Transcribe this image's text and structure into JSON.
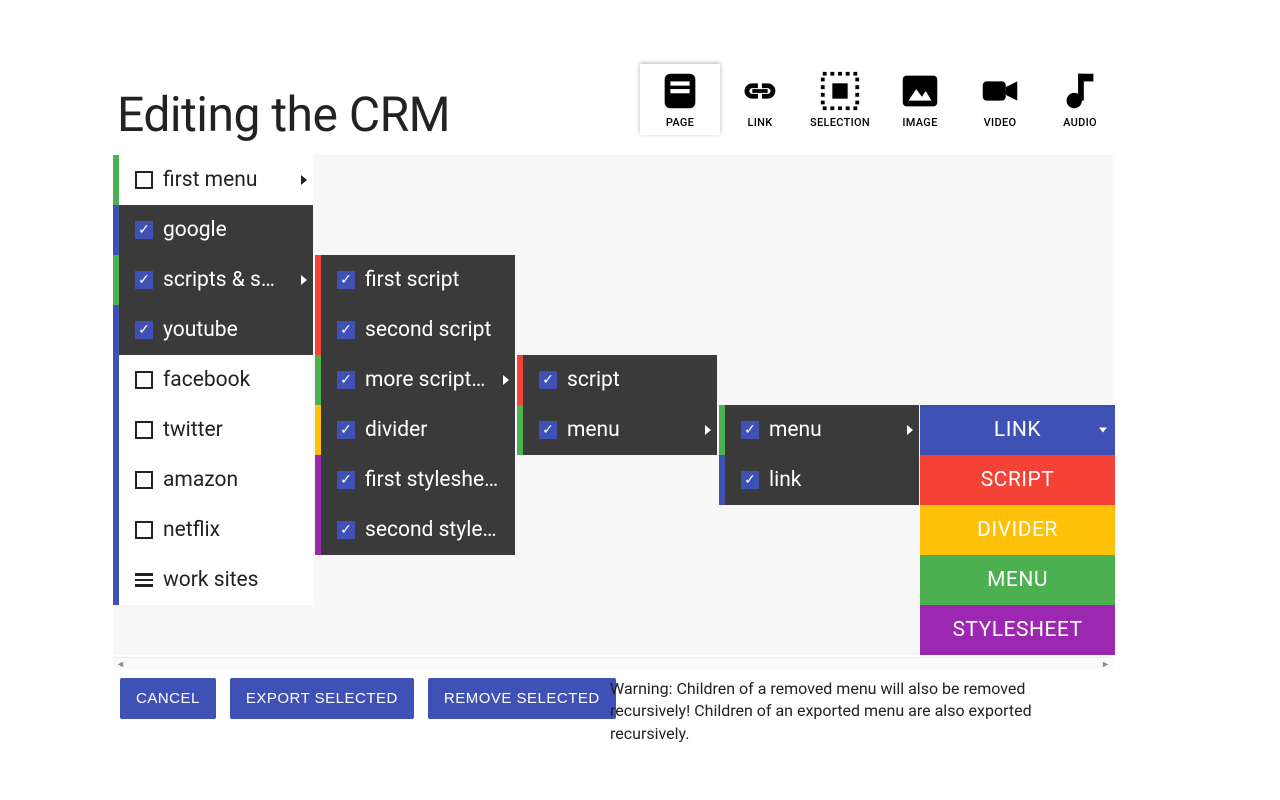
{
  "title": "Editing the CRM",
  "tabs": [
    {
      "id": "page",
      "label": "PAGE",
      "active": true
    },
    {
      "id": "link",
      "label": "LINK",
      "active": false
    },
    {
      "id": "selection",
      "label": "SELECTION",
      "active": false
    },
    {
      "id": "image",
      "label": "IMAGE",
      "active": false
    },
    {
      "id": "video",
      "label": "VIDEO",
      "active": false
    },
    {
      "id": "audio",
      "label": "AUDIO",
      "active": false
    }
  ],
  "columns": [
    {
      "items": [
        {
          "label": "first menu",
          "checked": false,
          "dark": false,
          "stripe": "green",
          "arrow": true,
          "kind": "check"
        },
        {
          "label": "google",
          "checked": true,
          "dark": true,
          "stripe": "blue",
          "arrow": false,
          "kind": "check"
        },
        {
          "label": "scripts & s…",
          "checked": true,
          "dark": true,
          "stripe": "green",
          "arrow": true,
          "kind": "check"
        },
        {
          "label": "youtube",
          "checked": true,
          "dark": true,
          "stripe": "blue",
          "arrow": false,
          "kind": "check"
        },
        {
          "label": "facebook",
          "checked": false,
          "dark": false,
          "stripe": "blue",
          "arrow": false,
          "kind": "check"
        },
        {
          "label": "twitter",
          "checked": false,
          "dark": false,
          "stripe": "blue",
          "arrow": false,
          "kind": "check"
        },
        {
          "label": "amazon",
          "checked": false,
          "dark": false,
          "stripe": "blue",
          "arrow": false,
          "kind": "check"
        },
        {
          "label": "netflix",
          "checked": false,
          "dark": false,
          "stripe": "blue",
          "arrow": false,
          "kind": "check"
        },
        {
          "label": "work sites",
          "checked": false,
          "dark": false,
          "stripe": "blue",
          "arrow": false,
          "kind": "menu"
        }
      ]
    },
    {
      "items": [
        {
          "label": "first script",
          "checked": true,
          "dark": true,
          "stripe": "red",
          "arrow": false,
          "kind": "check"
        },
        {
          "label": "second script",
          "checked": true,
          "dark": true,
          "stripe": "red",
          "arrow": false,
          "kind": "check"
        },
        {
          "label": "more script…",
          "checked": true,
          "dark": true,
          "stripe": "green",
          "arrow": true,
          "kind": "check"
        },
        {
          "label": "divider",
          "checked": true,
          "dark": true,
          "stripe": "yellow",
          "arrow": false,
          "kind": "check"
        },
        {
          "label": "first styleshe…",
          "checked": true,
          "dark": true,
          "stripe": "purple",
          "arrow": false,
          "kind": "check"
        },
        {
          "label": "second style…",
          "checked": true,
          "dark": true,
          "stripe": "purple",
          "arrow": false,
          "kind": "check"
        }
      ]
    },
    {
      "items": [
        {
          "label": "script",
          "checked": true,
          "dark": true,
          "stripe": "red",
          "arrow": false,
          "kind": "check"
        },
        {
          "label": "menu",
          "checked": true,
          "dark": true,
          "stripe": "green",
          "arrow": true,
          "kind": "check"
        }
      ]
    },
    {
      "items": [
        {
          "label": "menu",
          "checked": true,
          "dark": true,
          "stripe": "green",
          "arrow": true,
          "kind": "check"
        },
        {
          "label": "link",
          "checked": true,
          "dark": true,
          "stripe": "blue",
          "arrow": false,
          "kind": "check"
        }
      ]
    }
  ],
  "types": [
    {
      "label": "LINK",
      "color": "blue",
      "dropdown": true
    },
    {
      "label": "SCRIPT",
      "color": "red",
      "dropdown": false
    },
    {
      "label": "DIVIDER",
      "color": "yellow",
      "dropdown": false
    },
    {
      "label": "MENU",
      "color": "green",
      "dropdown": false
    },
    {
      "label": "STYLESHEET",
      "color": "purple",
      "dropdown": false
    }
  ],
  "buttons": {
    "cancel": "CANCEL",
    "export": "EXPORT SELECTED",
    "remove": "REMOVE SELECTED"
  },
  "warning": "Warning: Children of a removed menu will also be removed recursively! Children of an exported menu are also exported recursively.",
  "colors": {
    "blue": "#3F51B5",
    "red": "#F44336",
    "yellow": "#FFC107",
    "green": "#4CAF50",
    "purple": "#9C27B0"
  }
}
